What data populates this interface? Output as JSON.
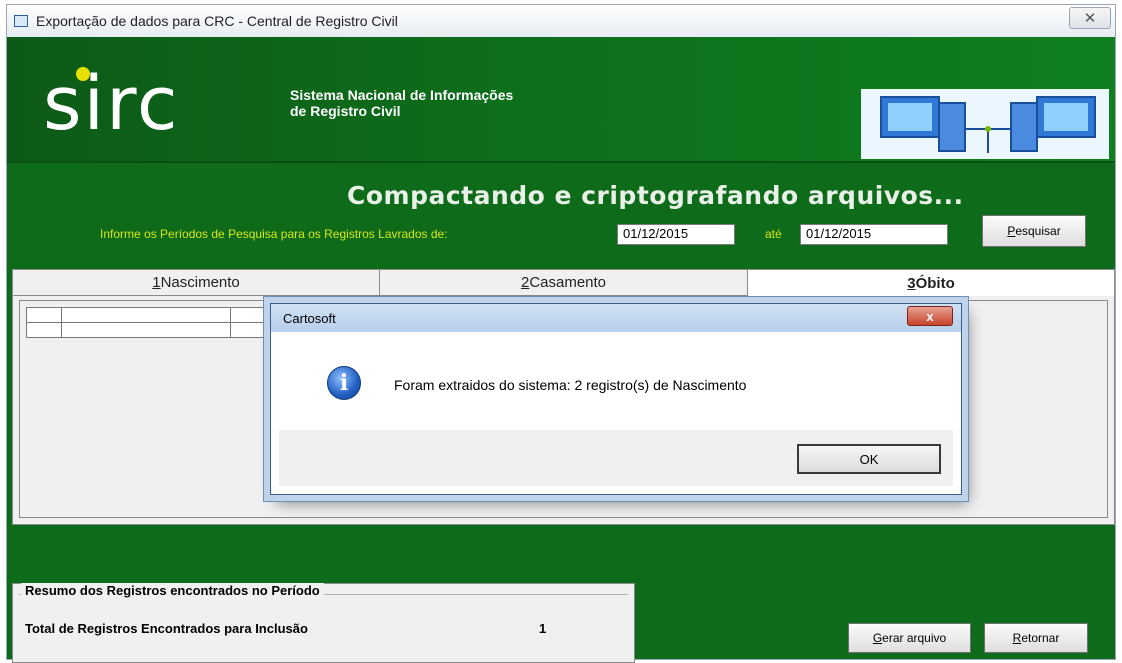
{
  "window": {
    "title": "Exportação de dados para CRC  - Central de Registro Civil",
    "close_glyph": "✕"
  },
  "header": {
    "logo_text": "sirc",
    "caption_line1": "Sistema Nacional de Informações",
    "caption_line2": "de Registro Civil"
  },
  "main": {
    "heading": "Compactando e criptografando arquivos...",
    "period_label": "Informe os Períodos de Pesquisa para os Registros Lavrados de:",
    "date_from": "01/12/2015",
    "ate_label": "até",
    "date_to": "01/12/2015",
    "search_button": {
      "mnemonic": "P",
      "rest": "esquisar"
    }
  },
  "tabs": [
    {
      "mnemonic": "1",
      "label": " Nascimento"
    },
    {
      "mnemonic": "2",
      "label": " Casamento"
    },
    {
      "mnemonic": "3",
      "label": " Óbito"
    }
  ],
  "summary": {
    "legend": "Resumo dos Registros encontrados no Período",
    "label": "Total de Registros Encontrados para Inclusão",
    "count": "1"
  },
  "footer": {
    "generate_button": {
      "mnemonic": "G",
      "rest": "erar arquivo"
    },
    "return_button": {
      "mnemonic": "R",
      "rest": "etornar"
    }
  },
  "dialog": {
    "title": "Cartosoft",
    "close_glyph": "x",
    "message": "Foram extraidos do sistema: 2 registro(s) de Nascimento",
    "ok_label": "OK",
    "icon": "info-icon"
  },
  "colors": {
    "header_green": "#0d6e1b",
    "main_green": "#0d6b1a",
    "label_yellow": "#d7e61a",
    "logo_dot": "#e6e000"
  }
}
